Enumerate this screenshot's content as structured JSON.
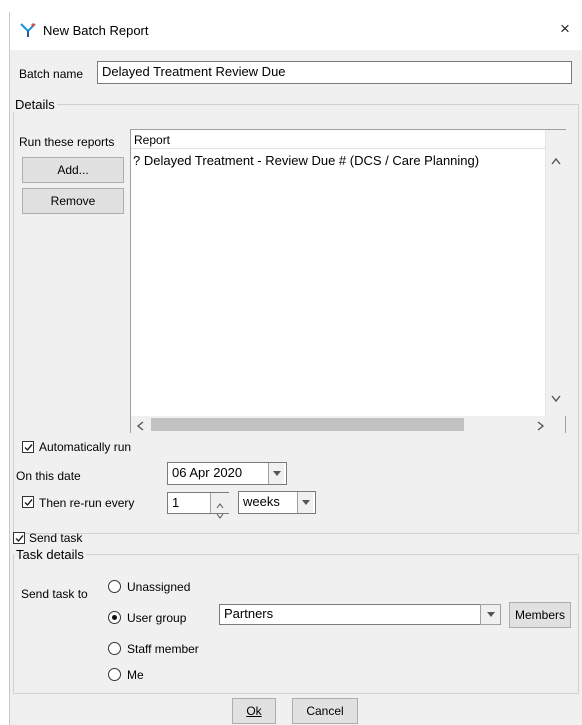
{
  "window": {
    "title": "New Batch Report",
    "close": "×"
  },
  "batch_name": {
    "label": "Batch name",
    "value": "Delayed Treatment Review Due"
  },
  "details": {
    "legend": "Details",
    "run_reports_label": "Run these reports",
    "add_label": "Add...",
    "remove_label": "Remove",
    "list_header": "Report",
    "reports": [
      "? Delayed Treatment - Review Due # (DCS / Care Planning)"
    ],
    "auto_run_label": "Automatically run",
    "auto_run_checked": true,
    "on_this_date_label": "On this date",
    "date_value": "06 Apr 2020",
    "rerun_label": "Then re-run every",
    "rerun_checked": true,
    "rerun_value": "1",
    "rerun_unit": "weeks"
  },
  "send_task": {
    "label": "Send task",
    "checked": true
  },
  "task_details": {
    "legend": "Task details",
    "send_to_label": "Send task to",
    "options": [
      "Unassigned",
      "User group",
      "Staff member",
      "Me"
    ],
    "selected": "User group",
    "group_value": "Partners",
    "members_label": "Members"
  },
  "footer": {
    "ok_label": "Ok",
    "cancel_label": "Cancel"
  }
}
